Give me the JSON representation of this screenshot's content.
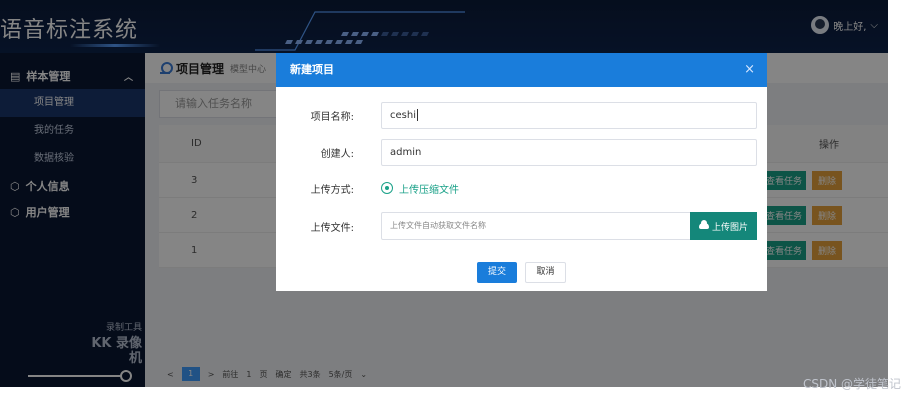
{
  "header": {
    "app_title": "语音标注系统",
    "greeting": "晚上好,"
  },
  "sidebar": {
    "groups": [
      {
        "label": "样本管理",
        "expanded": true,
        "items": [
          {
            "label": "项目管理",
            "active": true
          },
          {
            "label": "我的任务",
            "active": false
          },
          {
            "label": "数据核验",
            "active": false
          }
        ]
      },
      {
        "label": "个人信息"
      },
      {
        "label": "用户管理"
      }
    ],
    "watermark": {
      "line1": "录制工具",
      "line2": "KK 录像机"
    }
  },
  "main": {
    "breadcrumb_title": "项目管理",
    "breadcrumb_sub": "模型中心",
    "search_placeholder": "请输入任务名称",
    "table": {
      "id_header": "ID",
      "ops_header": "操作",
      "rows": [
        {
          "id": "3",
          "view": "查看任务",
          "delete": "删除"
        },
        {
          "id": "2",
          "view": "查看任务",
          "delete": "删除"
        },
        {
          "id": "1",
          "view": "查看任务",
          "delete": "删除"
        }
      ]
    },
    "pager": {
      "prev": "<",
      "page": "1",
      "next": ">",
      "goto_label": "前往",
      "goto_value": "1",
      "page_unit": "页",
      "confirm": "确定",
      "total": "共3条",
      "page_size": "5条/页"
    }
  },
  "modal": {
    "title": "新建项目",
    "close": "×",
    "fields": {
      "name_label": "项目名称:",
      "name_value": "ceshi",
      "creator_label": "创建人:",
      "creator_value": "admin",
      "method_label": "上传方式:",
      "method_option": "上传压缩文件",
      "file_label": "上传文件:",
      "file_placeholder": "上传文件自动获取文件名称",
      "upload_button": "上传图片"
    },
    "submit": "提交",
    "cancel": "取消"
  },
  "footer": {
    "csdn": "CSDN @学徒笔记"
  },
  "colors": {
    "header_bg": "#0b1b3a",
    "sidebar_bg": "#0b1833",
    "modal_header": "#1a7ddb",
    "teal": "#14877a",
    "orange": "#e6a23c"
  }
}
